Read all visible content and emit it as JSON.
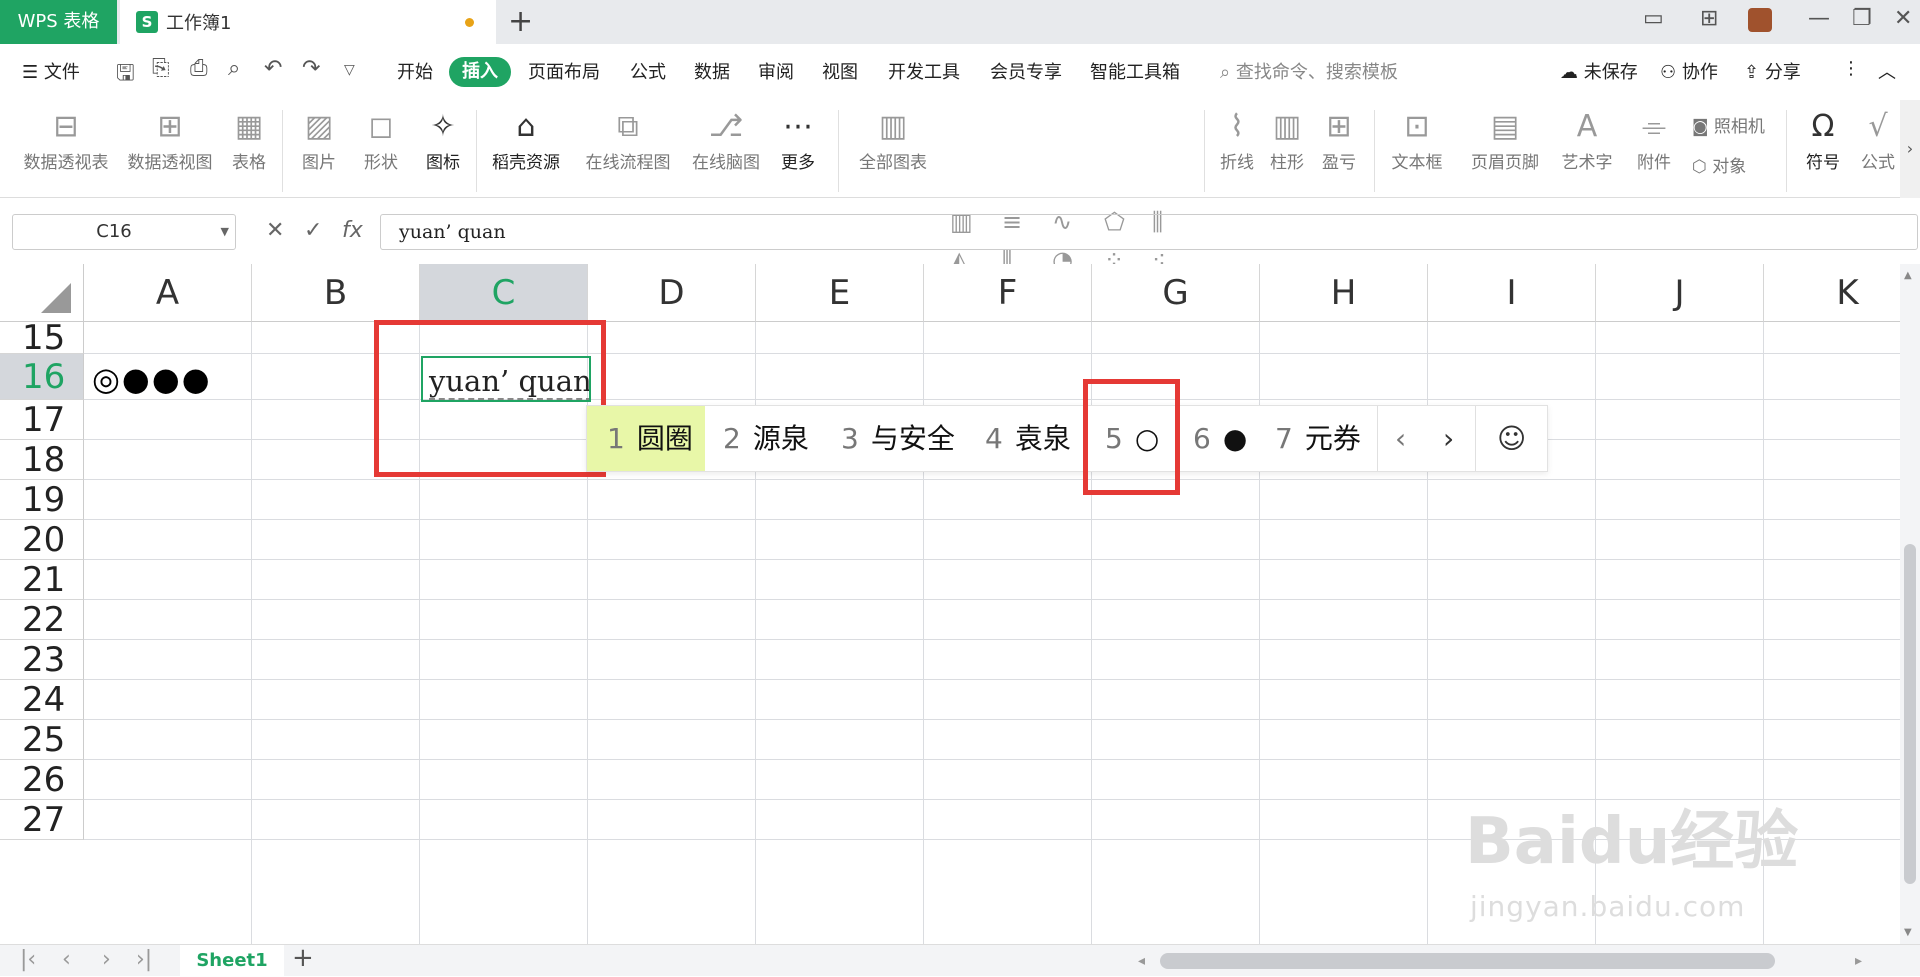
{
  "titlebar": {
    "app_tab": "WPS 表格",
    "doc_icon": "S",
    "doc_tab": "工作簿1",
    "new_tab": "+",
    "icons": [
      "layout-icon",
      "grid-icon",
      "avatar",
      "minimize-icon",
      "restore-icon",
      "close-icon"
    ]
  },
  "menubar": {
    "file": "文件",
    "tabs": [
      "开始",
      "插入",
      "页面布局",
      "公式",
      "数据",
      "审阅",
      "视图",
      "开发工具",
      "会员专享",
      "智能工具箱"
    ],
    "active_tab": "插入",
    "search": "查找命令、搜索模板",
    "unsaved": "未保存",
    "collab": "协作",
    "share": "分享"
  },
  "ribbon": {
    "pivot_table": "数据透视表",
    "pivot_chart": "数据透视图",
    "table": "表格",
    "picture": "图片",
    "shape": "形状",
    "icon": "图标",
    "docer": "稻壳资源",
    "flowchart": "在线流程图",
    "mindmap": "在线脑图",
    "more": "更多",
    "all_charts": "全部图表",
    "line": "折线",
    "column": "柱形",
    "winloss": "盈亏",
    "textbox": "文本框",
    "header_footer": "页眉页脚",
    "wordart": "艺术字",
    "attachment": "附件",
    "camera": "照相机",
    "object": "对象",
    "symbol": "符号",
    "formula": "公式"
  },
  "formula_bar": {
    "name_box": "C16",
    "fx": "fx",
    "value": "yuan’ quan"
  },
  "columns": [
    "A",
    "B",
    "C",
    "D",
    "E",
    "F",
    "G",
    "H",
    "I",
    "J",
    "K"
  ],
  "selected_column": "C",
  "rows": [
    "15",
    "16",
    "17",
    "18",
    "19",
    "20",
    "21",
    "22",
    "23",
    "24",
    "25",
    "26",
    "27"
  ],
  "selected_row": "16",
  "cells": {
    "A16": "◎●●●",
    "C16": "yuan’ quan"
  },
  "ime": {
    "candidates": [
      {
        "n": "1",
        "t": "圆圈"
      },
      {
        "n": "2",
        "t": "源泉"
      },
      {
        "n": "3",
        "t": "与安全"
      },
      {
        "n": "4",
        "t": "袁泉"
      },
      {
        "n": "5",
        "t": "○"
      },
      {
        "n": "6",
        "t": "●"
      },
      {
        "n": "7",
        "t": "元券"
      }
    ],
    "prev": "‹",
    "next": "›",
    "emoji": "☺"
  },
  "sheet": {
    "name": "Sheet1",
    "add": "+"
  },
  "watermark": {
    "logo": "Baidu经验",
    "url": "jingyan.baidu.com"
  },
  "colors": {
    "accent": "#1fa463",
    "highlight": "#e53935",
    "candidate_highlight": "#e8f7a8"
  }
}
